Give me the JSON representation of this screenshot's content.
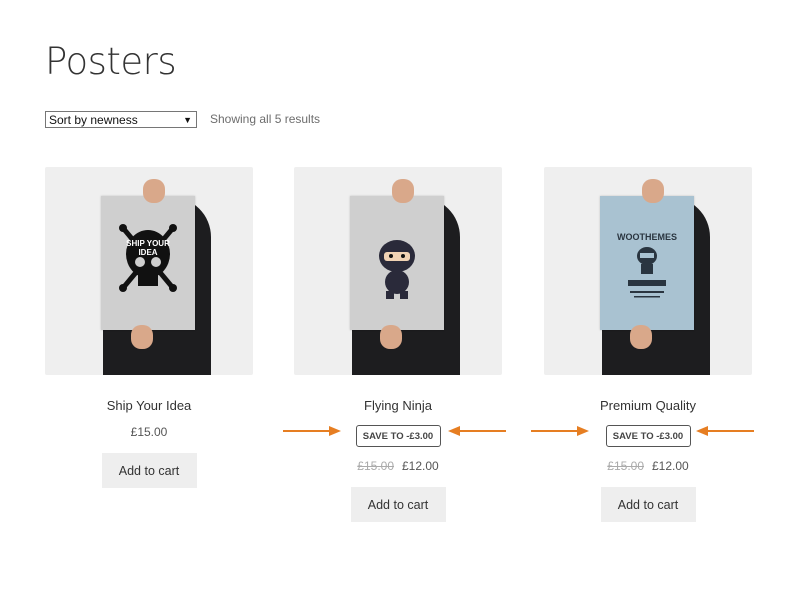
{
  "page": {
    "title": "Posters"
  },
  "toolbar": {
    "sort_selected": "Sort by newness",
    "result_count": "Showing all 5 results"
  },
  "colors": {
    "arrow": "#e67e22",
    "button_bg": "#eeeeee"
  },
  "products": [
    {
      "name": "Ship Your Idea",
      "price": "£15.00",
      "button": "Add to cart",
      "poster_text": "SHIP YOUR IDEA"
    },
    {
      "name": "Flying Ninja",
      "badge": "SAVE TO -£3.00",
      "old_price": "£15.00",
      "price": "£12.00",
      "button": "Add to cart"
    },
    {
      "name": "Premium Quality",
      "badge": "SAVE TO -£3.00",
      "old_price": "£15.00",
      "price": "£12.00",
      "button": "Add to cart",
      "poster_text": "WOOTHEMES"
    }
  ]
}
